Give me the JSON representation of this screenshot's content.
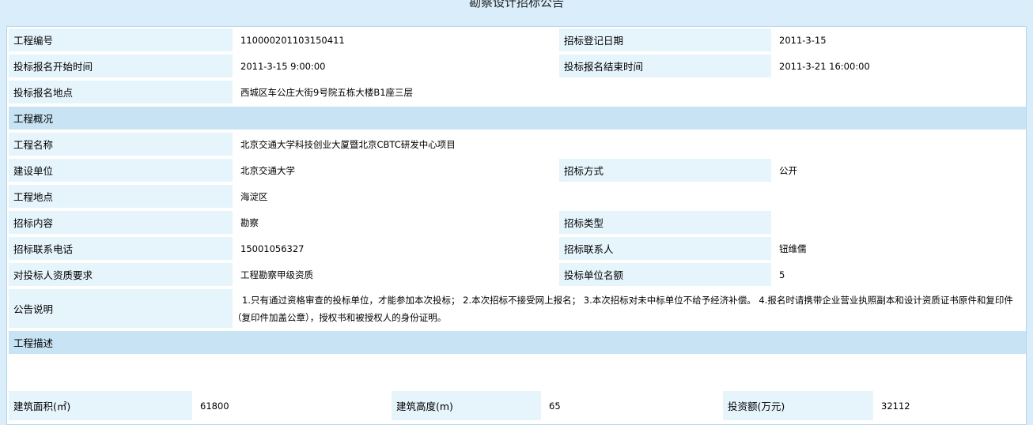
{
  "page": {
    "title": "勘察设计招标公告"
  },
  "rows": {
    "project_no_label": "工程编号",
    "project_no_value": "110000201103150411",
    "reg_date_label": "招标登记日期",
    "reg_date_value": "2011-3-15",
    "signup_start_label": "投标报名开始时间",
    "signup_start_value": "2011-3-15 9:00:00",
    "signup_end_label": "投标报名结束时间",
    "signup_end_value": "2011-3-21 16:00:00",
    "signup_place_label": "投标报名地点",
    "signup_place_value": "西城区车公庄大街9号院五栋大楼B1座三层",
    "overview_section": "工程概况",
    "project_name_label": "工程名称",
    "project_name_value": "北京交通大学科技创业大厦暨北京CBTC研发中心项目",
    "builder_label": "建设单位",
    "builder_value": "北京交通大学",
    "bid_method_label": "招标方式",
    "bid_method_value": "公开",
    "location_label": "工程地点",
    "location_value": "海淀区",
    "bid_content_label": "招标内容",
    "bid_content_value": "勘察",
    "bid_type_label": "招标类型",
    "bid_type_value": "",
    "phone_label": "招标联系电话",
    "phone_value": "15001056327",
    "contact_label": "招标联系人",
    "contact_value": "钮维儒",
    "qualification_label": "对投标人资质要求",
    "qualification_value": "工程勘察甲级资质",
    "quota_label": "投标单位名额",
    "quota_value": "5",
    "notice_label": "公告说明",
    "notice_value": "1.只有通过资格审查的投标单位，才能参加本次投标； 2.本次招标不接受网上报名； 3.本次招标对未中标单位不给予经济补偿。 4.报名时请携带企业营业执照副本和设计资质证书原件和复印件（复印件加盖公章），授权书和被授权人的身份证明。",
    "description_section": "工程描述"
  },
  "description": {
    "area_label": "建筑面积(㎡)",
    "area_value": "61800",
    "height_label": "建筑高度(m)",
    "height_value": "65",
    "investment_label": "投资额(万元)",
    "investment_value": "32112"
  }
}
